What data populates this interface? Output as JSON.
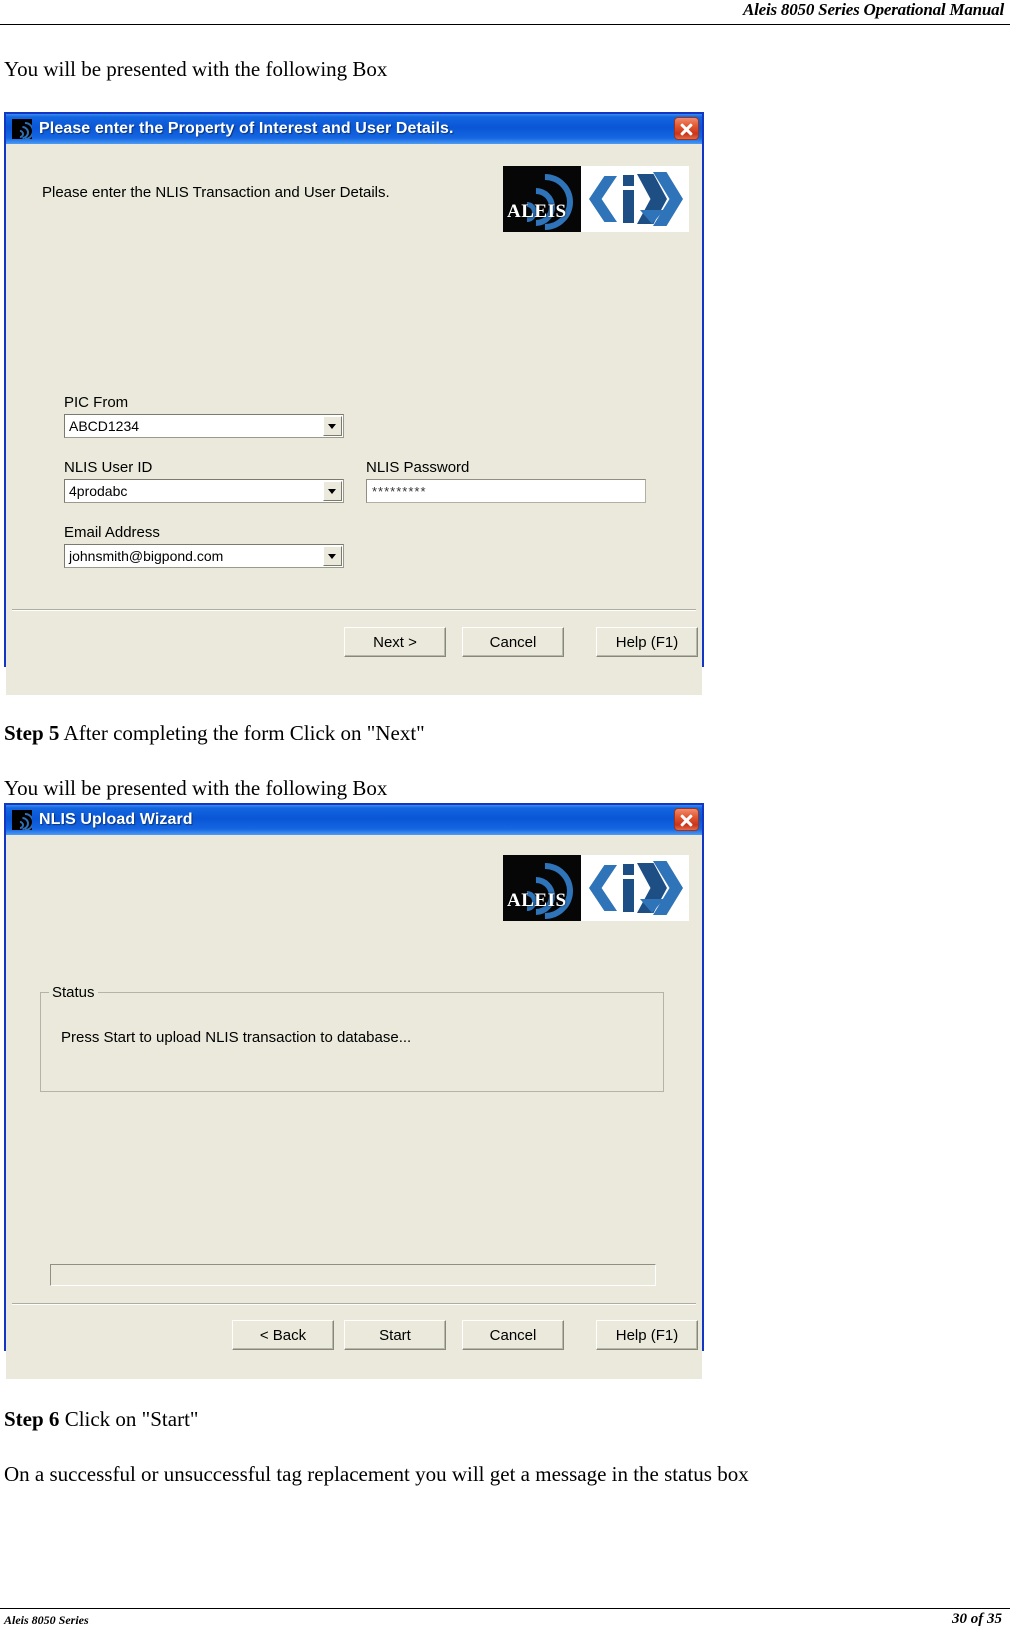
{
  "page": {
    "header_title": "Aleis 8050 Series Operational Manual",
    "footer_left": "Aleis 8050 Series",
    "footer_right": "30 of 35"
  },
  "body_text": {
    "intro_1": "You will be presented with the following Box",
    "step5_bold": "Step 5",
    "step5_rest": " After completing the form Click on \"Next\"",
    "intro_2": "You will be presented with the following Box",
    "step6_bold": "Step 6",
    "step6_rest": " Click on \"Start\"",
    "closing": "On a successful or unsuccessful tag replacement you will get a message in the status box"
  },
  "dialog1": {
    "title": "Please enter the Property of Interest and User Details.",
    "instruction": "Please enter the NLIS Transaction and User Details.",
    "logo_text": "ALEIS",
    "fields": {
      "pic_from_label": "PIC From",
      "pic_from_value": "ABCD1234",
      "user_id_label": "NLIS User ID",
      "user_id_value": "4prodabc",
      "password_label": "NLIS Password",
      "password_value": "*********",
      "email_label": "Email Address",
      "email_value": "johnsmith@bigpond.com"
    },
    "buttons": {
      "next": "Next >",
      "cancel": "Cancel",
      "help": "Help (F1)"
    }
  },
  "dialog2": {
    "title": "NLIS Upload Wizard",
    "logo_text": "ALEIS",
    "status_group_label": "Status",
    "status_message": "Press Start to upload NLIS transaction to database...",
    "buttons": {
      "back": "< Back",
      "start": "Start",
      "cancel": "Cancel",
      "help": "Help (F1)"
    }
  },
  "colors": {
    "titlebar_blue": "#0a56d6",
    "dialog_border_blue": "#1237c4",
    "dialog_face": "#eae9db",
    "close_red": "#c9341a",
    "logo_blue": "#2f73b8"
  }
}
